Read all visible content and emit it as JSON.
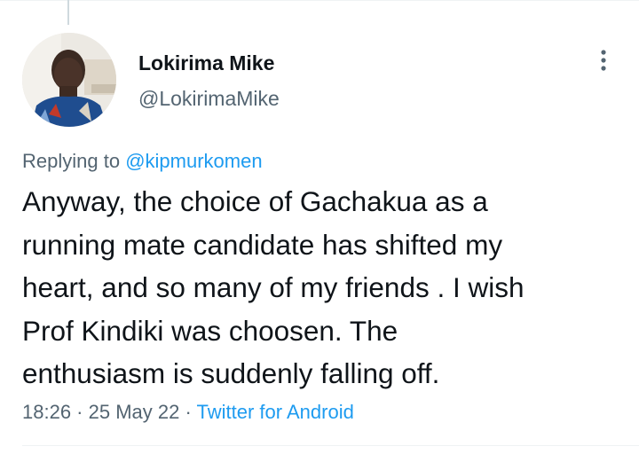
{
  "tweet": {
    "author": {
      "display_name": "Lokirima Mike",
      "handle": "@LokirimaMike",
      "avatar_icon": "profile-photo"
    },
    "reply_context": {
      "prefix": "Replying to ",
      "mention": "@kipmurkomen"
    },
    "text_lines": [
      "Anyway, the choice of Gachakua as a",
      "running mate candidate has shifted my",
      "heart, and so many of my friends . I wish",
      "Prof Kindiki was choosen. The",
      "enthusiasm is suddenly falling off."
    ],
    "time": "18:26",
    "separator": " · ",
    "date": "25 May 22",
    "source": "Twitter for Android",
    "more_icon": "more-vertical-icon"
  },
  "colors": {
    "text_primary": "#0f1419",
    "text_secondary": "#536471",
    "accent": "#1d9bf0",
    "divider": "#eff3f4",
    "thread_line": "#cfd9de"
  }
}
